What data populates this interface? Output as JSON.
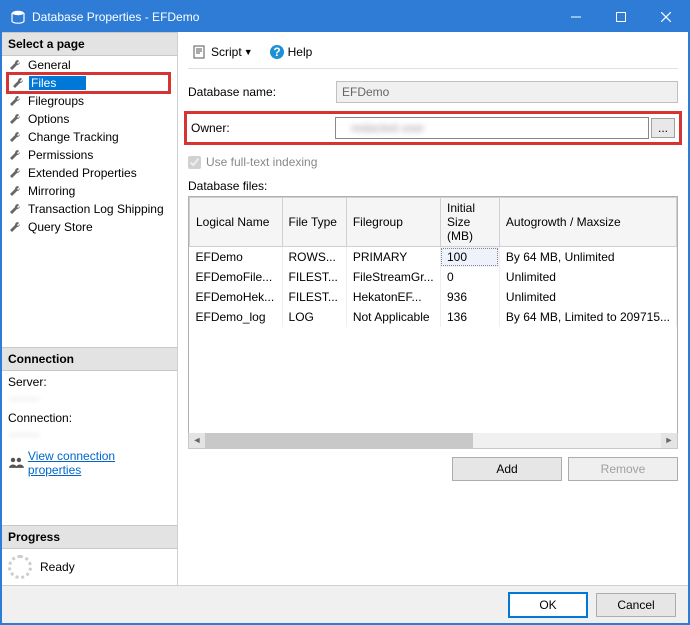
{
  "window": {
    "title": "Database Properties - EFDemo"
  },
  "sidebar": {
    "select_page_header": "Select a page",
    "pages": [
      "General",
      "Files",
      "Filegroups",
      "Options",
      "Change Tracking",
      "Permissions",
      "Extended Properties",
      "Mirroring",
      "Transaction Log Shipping",
      "Query Store"
    ],
    "connection_header": "Connection",
    "server_label": "Server:",
    "server_value": "········",
    "connection_label": "Connection:",
    "connection_value": "········",
    "view_conn_link": "View connection properties",
    "progress_header": "Progress",
    "progress_status": "Ready"
  },
  "toolbar": {
    "script_label": "Script",
    "help_label": "Help"
  },
  "form": {
    "dbname_label": "Database name:",
    "dbname_value": "EFDemo",
    "owner_label": "Owner:",
    "owner_value": "redacted user",
    "browse_label": "...",
    "fulltext_label": "Use full-text indexing",
    "files_label": "Database files:"
  },
  "grid": {
    "columns": [
      "Logical Name",
      "File Type",
      "Filegroup",
      "Initial Size (MB)",
      "Autogrowth / Maxsize"
    ],
    "rows": [
      {
        "name": "EFDemo",
        "ftype": "ROWS...",
        "fg": "PRIMARY",
        "size": "100",
        "auto": "By 64 MB, Unlimited"
      },
      {
        "name": "EFDemoFile...",
        "ftype": "FILEST...",
        "fg": "FileStreamGr...",
        "size": "0",
        "auto": "Unlimited"
      },
      {
        "name": "EFDemoHek...",
        "ftype": "FILEST...",
        "fg": "HekatonEF...",
        "size": "936",
        "auto": "Unlimited"
      },
      {
        "name": "EFDemo_log",
        "ftype": "LOG",
        "fg": "Not Applicable",
        "size": "136",
        "auto": "By 64 MB, Limited to 209715..."
      }
    ]
  },
  "buttons": {
    "add": "Add",
    "remove": "Remove",
    "ok": "OK",
    "cancel": "Cancel"
  }
}
